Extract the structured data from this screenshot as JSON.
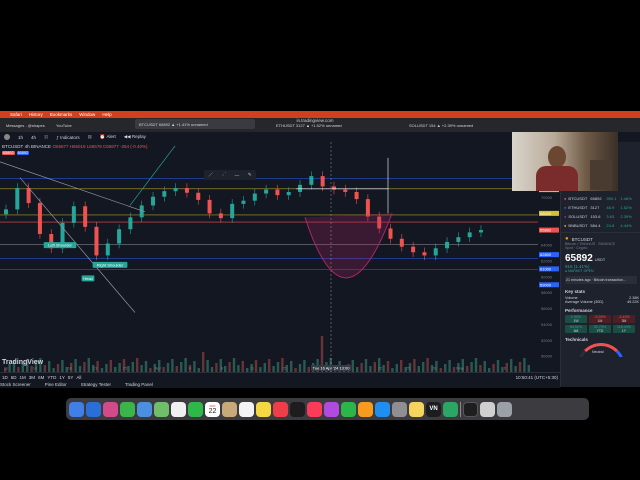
{
  "menubar": {
    "apple": "",
    "items": [
      "Safari",
      "History",
      "Bookmarks",
      "Window",
      "Help"
    ],
    "right": [
      "",
      "",
      "",
      ""
    ]
  },
  "browser": {
    "url": "in.tradingview.com",
    "tabs": [
      "Messages - @shapes",
      "YouTube",
      "BTCUSDT 65892 ▲ +1.41% unnamed",
      "ETHUSDT 3127 ▲ +1.52% unnamed",
      "SOLUSDT 154 ▲ +2.39% unnamed"
    ]
  },
  "toolbar": {
    "items": [
      "1h",
      "4h",
      "Indicators",
      "Alert",
      "Replay"
    ]
  },
  "symbol": {
    "name": "BTCUSDT",
    "interval": "4h",
    "exchange": "BINANCE",
    "prices": "O65877 H66019 L65578 C65877 -264 (-0.40%)",
    "sell": "65892",
    "buy": "65892"
  },
  "chart_data": {
    "type": "line",
    "x_ticks": [
      "11",
      "14",
      "18",
      "21",
      "25",
      "Apr",
      "4",
      "8",
      "11",
      "15",
      "Tue 16 Apr '24 13:00",
      "22",
      "25",
      "28",
      "May",
      "6"
    ],
    "y_ticks": [
      "76000",
      "74000",
      "72000",
      "70000",
      "68000",
      "66000",
      "64000",
      "62000",
      "60000",
      "58000",
      "56000",
      "54000",
      "52000",
      "50000"
    ],
    "annotations": [
      "Left Shoulder",
      "Head",
      "Right Shoulder"
    ],
    "price_labels": [
      "72780",
      "71000",
      "68000",
      "65892",
      "62800",
      "61000",
      "59000"
    ],
    "close": [
      68.5,
      71.2,
      69.3,
      65.4,
      63.6,
      66.8,
      68.9,
      66.3,
      62.7,
      64.2,
      66.0,
      67.5,
      69.0,
      70.1,
      70.8,
      71.2,
      70.6,
      69.7,
      68.0,
      67.4,
      69.2,
      69.6,
      70.5,
      71.0,
      70.3,
      70.7,
      71.6,
      72.7,
      71.4,
      71.0,
      70.7,
      69.8,
      67.6,
      66.1,
      64.8,
      63.8,
      63.1,
      62.7,
      63.6,
      64.4,
      65.0,
      65.6,
      65.9
    ]
  },
  "logo": "TradingView",
  "timezone": "10:50:41 (UTC+5:30)",
  "range_buttons": [
    "1D",
    "5D",
    "1M",
    "3M",
    "6M",
    "YTD",
    "1Y",
    "5Y",
    "All"
  ],
  "bottom_tabs": [
    "Stock Screener",
    "Pine Editor",
    "Strategy Tester",
    "Trading Panel"
  ],
  "watchlist": {
    "rows": [
      {
        "sym": "BTCUSDT",
        "price": "65892",
        "chg": "950.1",
        "pct": "1.46%"
      },
      {
        "sym": "ETHUSDT",
        "price": "3127",
        "chg": "46.9",
        "pct": "1.52%"
      },
      {
        "sym": "SOLUSDT",
        "price": "153.6",
        "chg": "3.63",
        "pct": "2.39%"
      },
      {
        "sym": "BNBUSDT",
        "price": "584.4",
        "chg": "24.8",
        "pct": "4.44%"
      }
    ]
  },
  "details": {
    "symbol": "BTCUSDT",
    "name": "Bitcoin / TetherUS",
    "exchange": "BINANCE",
    "type": "Spot · Crypto",
    "price": "65892",
    "currency": "USDT",
    "change": "916 (1.41%)",
    "status": "● MARKET OPEN",
    "news": "21 minutes ago · Bitcoin transaction...",
    "key_stats": "Key stats",
    "volume_label": "Volume",
    "volume": "2.38K",
    "avg_vol_label": "Average Volume (30D)",
    "avg_vol": "49.22K",
    "performance": "Performance",
    "perf": [
      {
        "v": "1.93%",
        "p": "1W"
      },
      {
        "v": "-5.28%",
        "p": "1M"
      },
      {
        "v": "-3.43%",
        "p": "3M"
      },
      {
        "v": "64.51%",
        "p": "6M"
      },
      {
        "v": "52.73%",
        "p": "YTD"
      },
      {
        "v": "116.44%",
        "p": "1Y"
      }
    ],
    "technicals": "Technicals",
    "neutral": "Neutral"
  },
  "dock": {
    "calendar_month": "APR",
    "calendar_day": "22"
  },
  "colors": {
    "accent": "#2962ff",
    "up": "#26a69a",
    "down": "#ef5350",
    "yellow": "#d4c22a",
    "menubar": "#d0401e",
    "cup": "#b02468"
  }
}
